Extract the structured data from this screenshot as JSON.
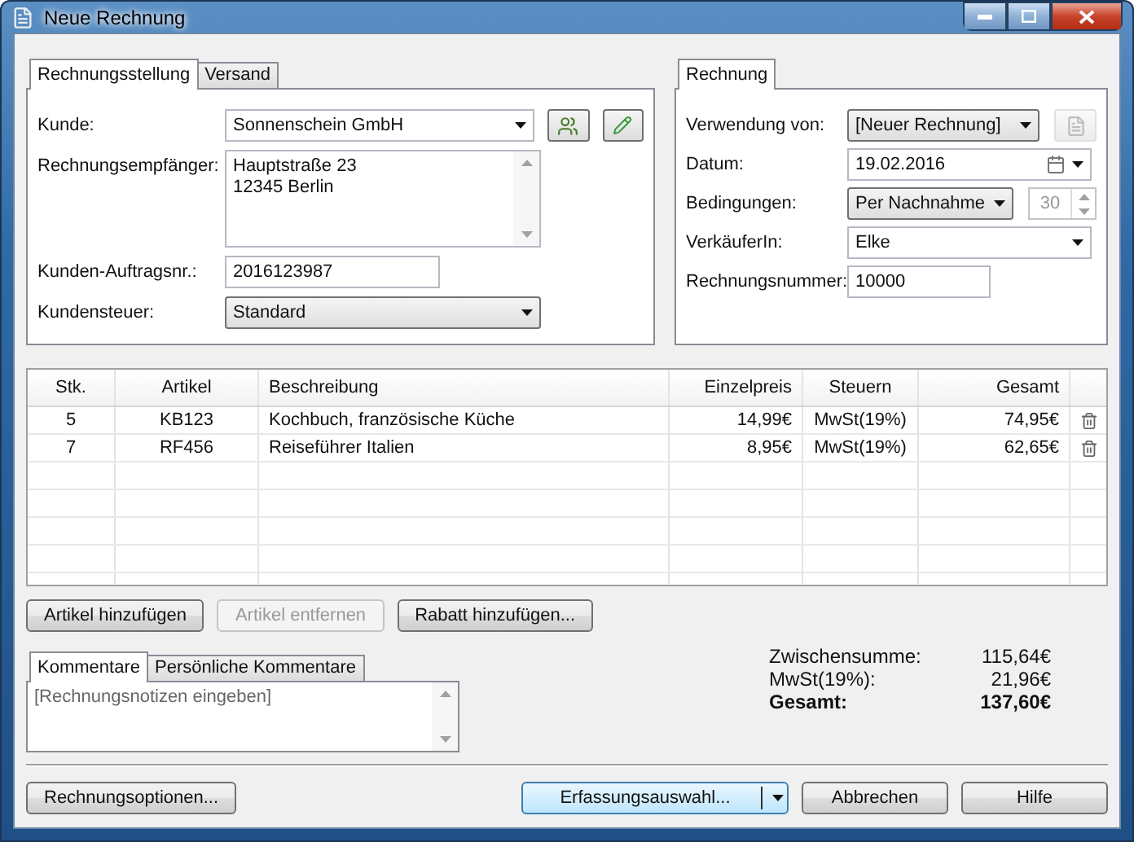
{
  "window": {
    "title": "Neue Rechnung"
  },
  "billing": {
    "tabs": [
      {
        "label": "Rechnungsstellung",
        "selected": true
      },
      {
        "label": "Versand",
        "selected": false
      }
    ],
    "fields": [
      {
        "kind": "combo",
        "label": "Kunde:",
        "value": "Sonnenschein GmbH",
        "addon": {
          "kind": "contact-buttons"
        }
      },
      {
        "kind": "textarea",
        "label": "Rechnungsempfänger:",
        "lines": [
          "Hauptstraße 23",
          "12345 Berlin"
        ]
      },
      {
        "kind": "input",
        "label": "Kunden-Auftragsnr.:",
        "value": "2016123987"
      },
      {
        "kind": "select",
        "label": "Kundensteuer:",
        "value": "Standard"
      }
    ]
  },
  "invoice": {
    "tabs": [
      {
        "label": "Rechnung",
        "selected": true
      }
    ],
    "fields": [
      {
        "kind": "select",
        "label": "Verwendung von:",
        "value": "[Neuer Rechnung]",
        "addon": {
          "kind": "document",
          "disabled": true
        }
      },
      {
        "kind": "date",
        "label": "Datum:",
        "value": "19.02.2016"
      },
      {
        "kind": "select",
        "label": "Bedingungen:",
        "value": "Per Nachnahme",
        "addon": {
          "kind": "spinner",
          "value": "30",
          "disabled": true
        }
      },
      {
        "kind": "combo",
        "label": "VerkäuferIn:",
        "value": "Elke"
      },
      {
        "kind": "input",
        "label": "Rechnungsnummer:",
        "value": "10000"
      }
    ]
  },
  "table": {
    "columns": [
      "Stk.",
      "Artikel",
      "Beschreibung",
      "Einzelpreis",
      "Steuern",
      "Gesamt"
    ],
    "rows": [
      [
        "5",
        "KB123",
        "Kochbuch, französische Küche",
        "14,99€",
        "MwSt(19%)",
        "74,95€"
      ],
      [
        "7",
        "RF456",
        "Reiseführer Italien",
        "8,95€",
        "MwSt(19%)",
        "62,65€"
      ]
    ]
  },
  "item_buttons": [
    {
      "label": "Artikel hinzufügen",
      "disabled": false
    },
    {
      "label": "Artikel entfernen",
      "disabled": true
    },
    {
      "label": "Rabatt hinzufügen...",
      "disabled": false
    }
  ],
  "comments": {
    "tabs": [
      {
        "label": "Kommentare",
        "selected": true
      },
      {
        "label": "Persönliche Kommentare",
        "selected": false
      }
    ],
    "placeholder": "[Rechnungsnotizen eingeben]"
  },
  "totals": [
    {
      "kind": "line",
      "label": "Zwischensumme:",
      "value": "115,64€"
    },
    {
      "kind": "line",
      "label": "MwSt(19%):",
      "value": "21,96€"
    },
    {
      "kind": "total",
      "label": "Gesamt:",
      "value": "137,60€"
    }
  ],
  "footer_buttons": [
    {
      "kind": "plain",
      "label": "Rechnungsoptionen..."
    },
    {
      "kind": "split",
      "label": "Erfassungsauswahl..."
    },
    {
      "kind": "plain",
      "label": "Abbrechen"
    },
    {
      "kind": "plain",
      "label": "Hilfe"
    }
  ]
}
